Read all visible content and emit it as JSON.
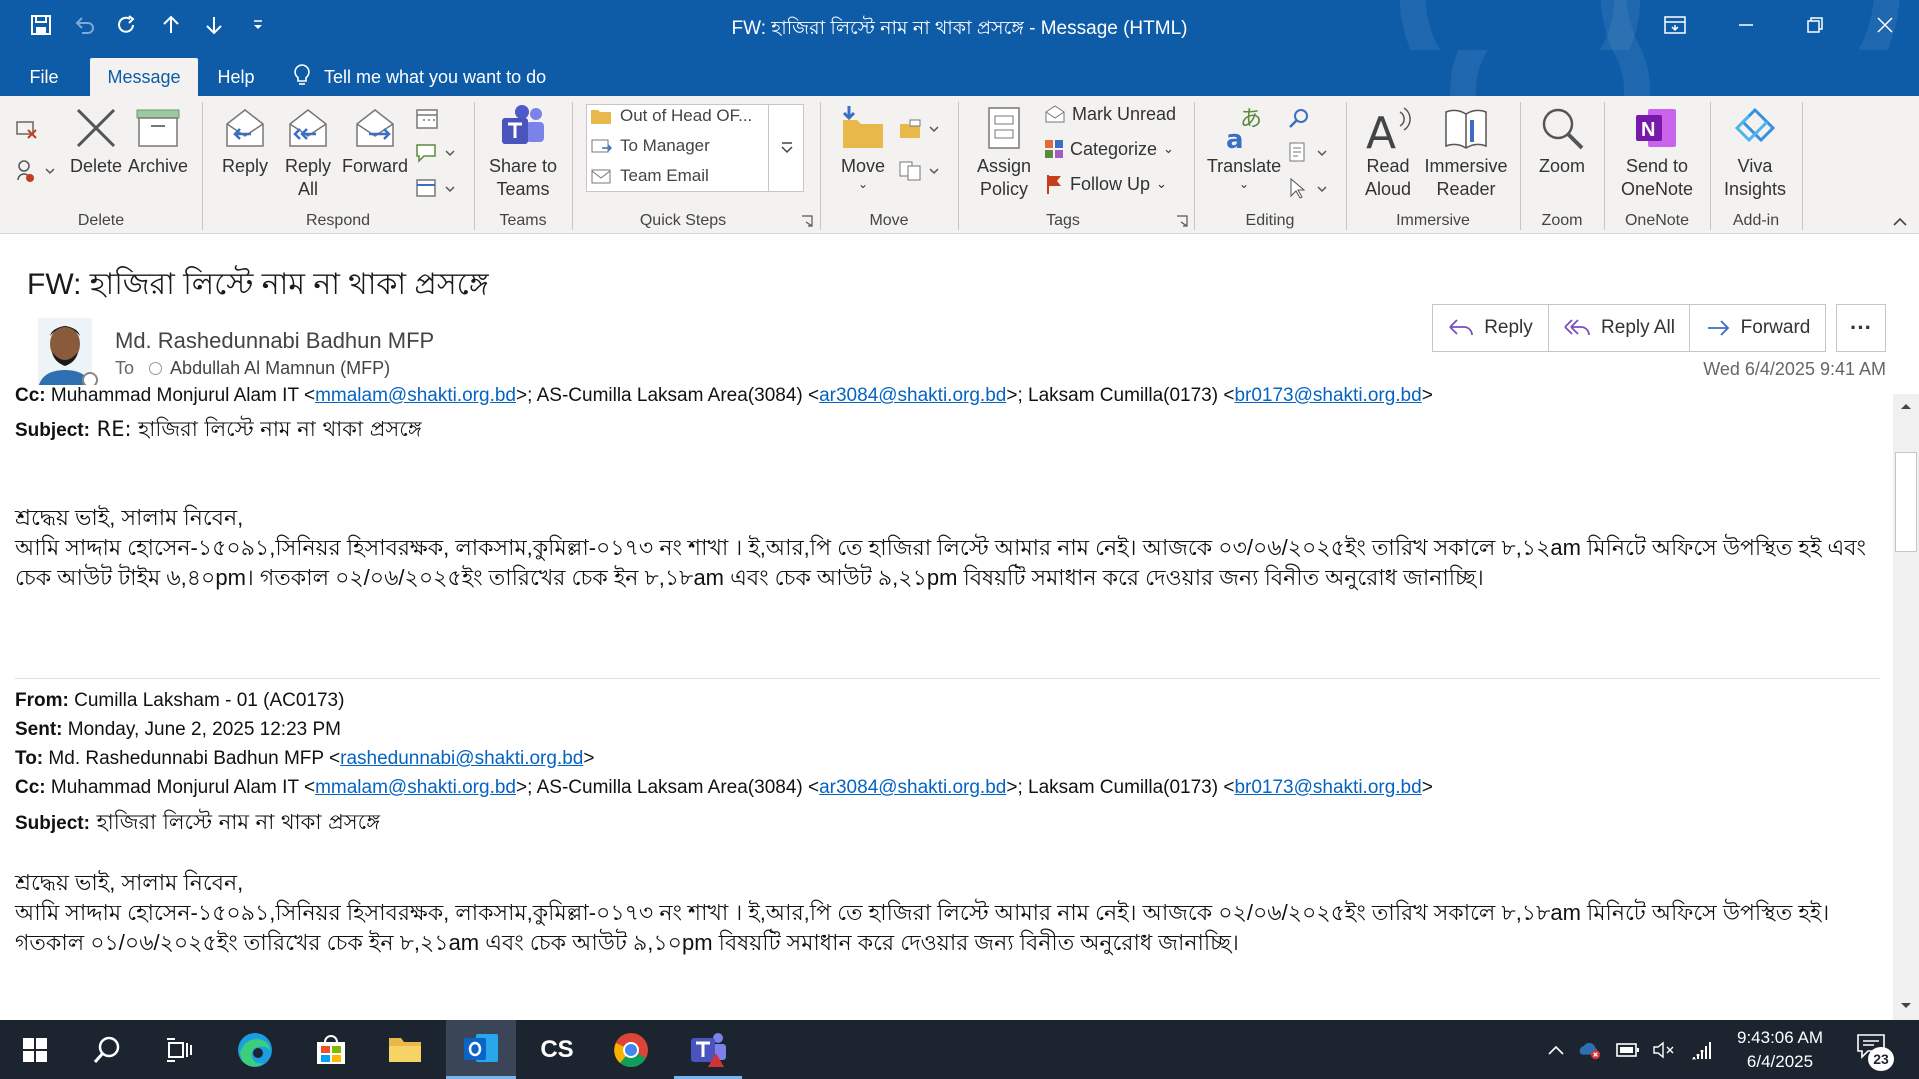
{
  "window": {
    "title": "FW: হাজিরা লিস্টে নাম না থাকা প্রসঙ্গে  -  Message (HTML)"
  },
  "tabs": [
    {
      "label": "File",
      "active": false
    },
    {
      "label": "Message",
      "active": true
    },
    {
      "label": "Help",
      "active": false
    }
  ],
  "tell_me": "Tell me what you want to do",
  "ribbon": {
    "delete_group": {
      "delete": "Delete",
      "archive": "Archive",
      "label": "Delete"
    },
    "respond_group": {
      "reply": "Reply",
      "reply_all_1": "Reply",
      "reply_all_2": "All",
      "forward": "Forward",
      "label": "Respond"
    },
    "teams_group": {
      "share_1": "Share to",
      "share_2": "Teams",
      "label": "Teams"
    },
    "quick_steps": {
      "items": [
        "Out of Head OF...",
        "To Manager",
        "Team Email"
      ],
      "label": "Quick Steps"
    },
    "move_group": {
      "move": "Move",
      "label": "Move"
    },
    "tags_group": {
      "assign_1": "Assign",
      "assign_2": "Policy",
      "mark_unread": "Mark Unread",
      "categorize": "Categorize",
      "follow_up": "Follow Up",
      "label": "Tags"
    },
    "editing_group": {
      "translate": "Translate",
      "label": "Editing"
    },
    "immersive_group": {
      "read_1": "Read",
      "read_2": "Aloud",
      "reader_1": "Immersive",
      "reader_2": "Reader",
      "label": "Immersive"
    },
    "zoom_group": {
      "zoom": "Zoom",
      "label": "Zoom"
    },
    "onenote_group": {
      "send_1": "Send to",
      "send_2": "OneNote",
      "label": "OneNote"
    },
    "addin_group": {
      "viva_1": "Viva",
      "viva_2": "Insights",
      "label": "Add-in"
    }
  },
  "message": {
    "subject": "FW: হাজিরা লিস্টে নাম না থাকা প্রসঙ্গে",
    "sender": "Md. Rashedunnabi Badhun MFP",
    "to_label": "To",
    "to_name": "Abdullah Al Mamnun (MFP)",
    "date": "Wed 6/4/2025 9:41 AM",
    "actions": {
      "reply": "Reply",
      "reply_all": "Reply All",
      "forward": "Forward",
      "more": "···"
    }
  },
  "body": {
    "cc1": {
      "label": "Cc:",
      "text1": " Muhammad Monjurul Alam IT <",
      "link1": "mmalam@shakti.org.bd",
      "text2": ">; AS-Cumilla Laksam Area(3084) <",
      "link2": "ar3084@shakti.org.bd",
      "text3": ">; Laksam Cumilla(0173) <",
      "link3": "br0173@shakti.org.bd",
      "text4": ">"
    },
    "subject1": {
      "label": "Subject:",
      "text": " RE: হাজিরা  লিস্টে  নাম  না  থাকা  প্রসঙ্গে"
    },
    "greeting1": "শ্রদ্ধেয় ভাই, সালাম নিবেন,",
    "para1": "আমি সাদ্দাম হোসেন-১৫০৯১,সিনিয়র হিসাবরক্ষক, লাকসাম,কুমিল্লা-০১৭৩ নং শাখা । ই,আর,পি তে হাজিরা লিস্টে আমার নাম নেই।  আজকে ০৩/০৬/২০২৫ইং তারিখ সকালে ৮,১২am মিনিটে অফিসে উপস্থিত হই এবং চেক আউট টাইম ৬,৪০pm। গতকাল ০২/০৬/২০২৫ইং তারিখের চেক ইন ৮,১৮am এবং চেক আউট ৯,২১pm বিষয়টি সমাধান করে দেওয়ার জন্য বিনীত অনুরোধ জানাচ্ছি।",
    "from": {
      "label": "From:",
      "text": " Cumilla Laksham - 01 (AC0173)"
    },
    "sent": {
      "label": "Sent:",
      "text": " Monday, June 2, 2025 12:23 PM"
    },
    "to": {
      "label": "To:",
      "text": " Md. Rashedunnabi Badhun MFP <",
      "link": "rashedunnabi@shakti.org.bd",
      "text2": ">"
    },
    "cc2": {
      "label": "Cc:",
      "text1": " Muhammad Monjurul Alam IT <",
      "link1": "mmalam@shakti.org.bd",
      "text2": ">; AS-Cumilla Laksam Area(3084) <",
      "link2": "ar3084@shakti.org.bd",
      "text3": ">; Laksam Cumilla(0173) <",
      "link3": "br0173@shakti.org.bd",
      "text4": ">"
    },
    "subject2": {
      "label": "Subject:",
      "text": " হাজিরা  লিস্টে  নাম  না  থাকা  প্রসঙ্গে"
    },
    "greeting2": "শ্রদ্ধেয় ভাই, সালাম নিবেন,",
    "para2": "আমি সাদ্দাম হোসেন-১৫০৯১,সিনিয়র হিসাবরক্ষক, লাকসাম,কুমিল্লা-০১৭৩ নং শাখা । ই,আর,পি তে হাজিরা লিস্টে আমার নাম নেই।  আজকে ০২/০৬/২০২৫ইং তারিখ সকালে ৮,১৮am মিনিটে অফিসে উপস্থিত হই। গতকাল ০১/০৬/২০২৫ইং তারিখের চেক ইন ৮,২১am এবং চেক আউট ৯,১০pm বিষয়টি সমাধান করে দেওয়ার জন্য বিনীত অনুরোধ জানাচ্ছি।"
  },
  "taskbar": {
    "clock_time": "9:43:06 AM",
    "clock_date": "6/4/2025",
    "notifications": "23",
    "cs_label": "CS"
  },
  "colors": {
    "titlebar": "#0e5ca8",
    "taskbar": "#1c2430",
    "link": "#0563c1",
    "ribbon": "#f3f2f1"
  }
}
